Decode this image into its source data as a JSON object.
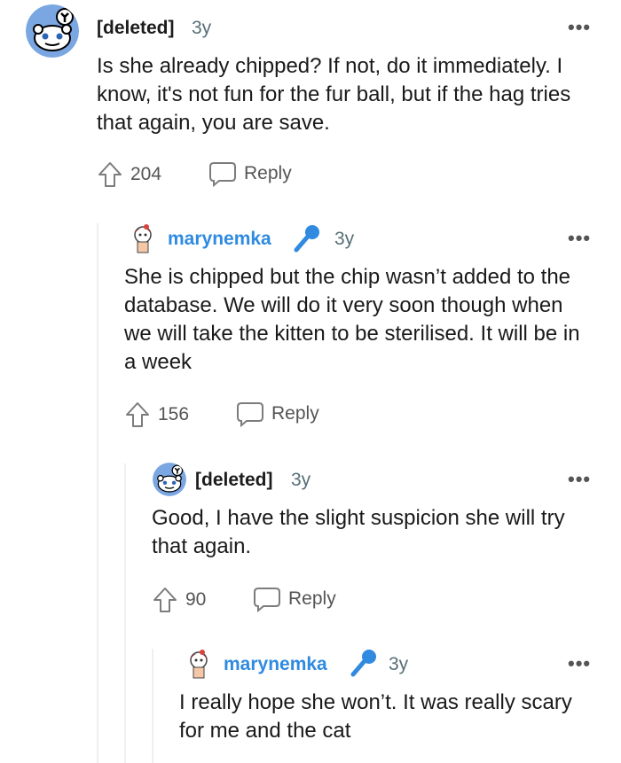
{
  "comments": [
    {
      "username": "[deleted]",
      "age": "3y",
      "body": "Is she already chipped? If not, do it immediately. I know, it's not fun for the fur ball, but if the hag tries that again, you are save.",
      "votes": "204",
      "reply_label": "Reply"
    },
    {
      "username": "marynemka",
      "age": "3y",
      "body": "She is chipped but the chip wasn’t added to the database. We will do it very soon though when we will take the kitten to be sterilised. It will be in a week",
      "votes": "156",
      "reply_label": "Reply"
    },
    {
      "username": "[deleted]",
      "age": "3y",
      "body": "Good, I have the slight suspicion she will try that again.",
      "votes": "90",
      "reply_label": "Reply"
    },
    {
      "username": "marynemka",
      "age": "3y",
      "body": "I really hope she won’t. It was really scary for me and the cat"
    }
  ],
  "icons": {
    "avatar_deleted": "snoo-avatar-icon",
    "avatar_op": "user-avatar-icon",
    "op_badge": "microphone-icon",
    "more": "more-options-icon",
    "upvote": "upvote-arrow-icon",
    "reply": "reply-bubble-icon"
  },
  "colors": {
    "op_username": "#2f8ae0",
    "avatar_bg": "#6f9fdc"
  }
}
